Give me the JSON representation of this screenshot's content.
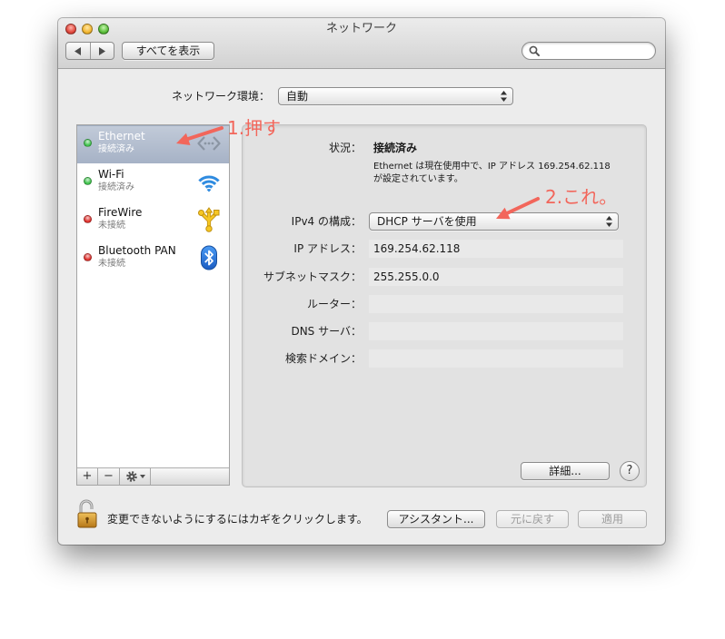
{
  "window": {
    "title": "ネットワーク"
  },
  "toolbar": {
    "back_icon": "chevron-left-icon",
    "forward_icon": "chevron-right-icon",
    "show_all_label": "すべてを表示",
    "search_icon": "search-icon"
  },
  "location": {
    "label": "ネットワーク環境：",
    "value": "自動"
  },
  "sidebar": {
    "items": [
      {
        "name": "Ethernet",
        "status": "接続済み",
        "dot_color": "#3fc34c",
        "icon": "ethernet-icon",
        "selected": true
      },
      {
        "name": "Wi-Fi",
        "status": "接続済み",
        "dot_color": "#3fc34c",
        "icon": "wifi-icon",
        "selected": false
      },
      {
        "name": "FireWire",
        "status": "未接続",
        "dot_color": "#e0302c",
        "icon": "firewire-icon",
        "selected": false
      },
      {
        "name": "Bluetooth PAN",
        "status": "未接続",
        "dot_color": "#e0302c",
        "icon": "bluetooth-icon",
        "selected": false
      }
    ],
    "add_label": "+",
    "remove_label": "−",
    "action_icon": "gear-icon"
  },
  "detail": {
    "status_label": "状況：",
    "status_value": "接続済み",
    "status_desc": [
      "Ethernet は現在使用中で、IP アドレス 169.254.62.118",
      "が設定されています。"
    ],
    "ipv4_label": "IPv4 の構成：",
    "ipv4_value": "DHCP サーバを使用",
    "ip_label": "IP アドレス：",
    "ip_value": "169.254.62.118",
    "subnet_label": "サブネットマスク：",
    "subnet_value": "255.255.0.0",
    "router_label": "ルーター：",
    "router_value": "",
    "dns_label": "DNS サーバ：",
    "dns_value": "",
    "search_domain_label": "検索ドメイン：",
    "search_domain_value": "",
    "advanced_label": "詳細...",
    "help_label": "?"
  },
  "footer": {
    "lock_icon": "unlocked-padlock-icon",
    "lock_text": "変更できないようにするにはカギをクリックします。",
    "assistant_label": "アシスタント...",
    "revert_label": "元に戻す",
    "revert_enabled": false,
    "apply_label": "適用",
    "apply_enabled": false
  },
  "annotations": {
    "step1": "1.押す",
    "step2": "2.これ。"
  },
  "colors": {
    "selection": "#a6b2c6",
    "annotation": "#f2665b",
    "wifi_blue": "#2f8be0",
    "bluetooth_blue": "#2a78de",
    "firewire_yellow": "#f6c724"
  }
}
